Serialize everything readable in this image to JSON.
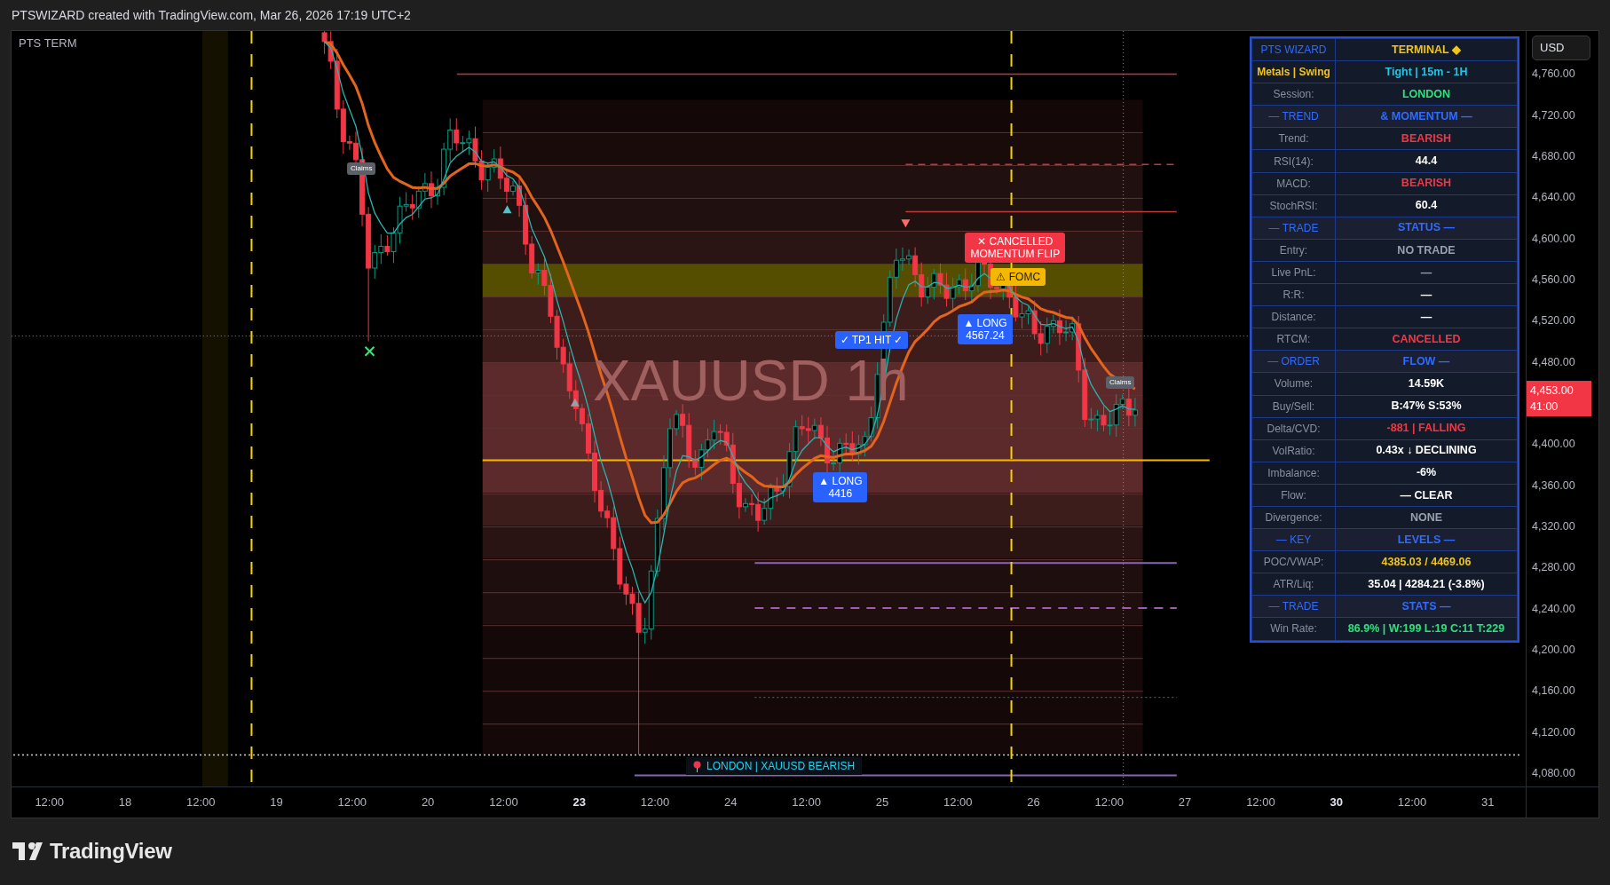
{
  "header": {
    "title": "PTSWIZARD created with TradingView.com, Mar 26, 2026 17:19 UTC+2"
  },
  "chart": {
    "indicator_title": "PTS TERM",
    "symbol_watermark": "XAUUSD  1h",
    "annotations": [
      {
        "kind": "tag",
        "lines": [
          "Claims"
        ]
      },
      {
        "kind": "tag",
        "lines": [
          "Claims"
        ]
      },
      {
        "kind": "signal",
        "lines": [
          "✓ TP1 HIT ✓"
        ]
      },
      {
        "kind": "signal",
        "lines": [
          "▲ LONG",
          "4567.24"
        ]
      },
      {
        "kind": "signal",
        "lines": [
          "▲ LONG",
          "4416"
        ]
      },
      {
        "kind": "alert",
        "lines": [
          "✕ CANCELLED",
          "MOMENTUM FLIP"
        ]
      },
      {
        "kind": "event",
        "lines": [
          "⚠ FOMC"
        ]
      }
    ],
    "session_banner": "LONDON | XAUUSD BEARISH"
  },
  "terminal": {
    "rows": [
      {
        "kind": "title",
        "label": "PTS WIZARD",
        "value": "TERMINAL ◆",
        "color": "#f0c419"
      },
      {
        "kind": "subtitle",
        "label": "Metals | Swing",
        "value": "Tight | 15m - 1H",
        "color": "#22c5e0"
      },
      {
        "kind": "data",
        "label": "Session:",
        "value": "LONDON",
        "color": "#2ee07a"
      },
      {
        "kind": "section",
        "label": "— TREND",
        "value": "& MOMENTUM —"
      },
      {
        "kind": "data",
        "label": "Trend:",
        "value": "BEARISH",
        "color": "#f23645"
      },
      {
        "kind": "data",
        "label": "RSI(14):",
        "value": "44.4",
        "color": "#ffffff"
      },
      {
        "kind": "data",
        "label": "MACD:",
        "value": "BEARISH",
        "color": "#f23645"
      },
      {
        "kind": "data",
        "label": "StochRSI:",
        "value": "60.4",
        "color": "#ffffff"
      },
      {
        "kind": "section",
        "label": "— TRADE",
        "value": "STATUS —"
      },
      {
        "kind": "data",
        "label": "Entry:",
        "value": "NO TRADE",
        "color": "#9aa0ab"
      },
      {
        "kind": "data",
        "label": "Live PnL:",
        "value": "—",
        "color": "#9aa0ab"
      },
      {
        "kind": "data",
        "label": "R:R:",
        "value": "—",
        "color": "#ffffff"
      },
      {
        "kind": "data",
        "label": "Distance:",
        "value": "—",
        "color": "#ffffff"
      },
      {
        "kind": "data",
        "label": "RTCM:",
        "value": "CANCELLED",
        "color": "#f23645"
      },
      {
        "kind": "section",
        "label": "— ORDER",
        "value": "FLOW —"
      },
      {
        "kind": "data",
        "label": "Volume:",
        "value": "14.59K",
        "color": "#ffffff"
      },
      {
        "kind": "data",
        "label": "Buy/Sell:",
        "value": "B:47% S:53%",
        "color": "#ffffff"
      },
      {
        "kind": "data",
        "label": "Delta/CVD:",
        "value": "-881 | FALLING",
        "color": "#f23645"
      },
      {
        "kind": "data",
        "label": "VolRatio:",
        "value": "0.43x ↓ DECLINING",
        "color": "#ffffff"
      },
      {
        "kind": "data",
        "label": "Imbalance:",
        "value": "-6%",
        "color": "#ffffff"
      },
      {
        "kind": "data",
        "label": "Flow:",
        "value": "— CLEAR",
        "color": "#ffffff"
      },
      {
        "kind": "data",
        "label": "Divergence:",
        "value": "NONE",
        "color": "#9aa0ab"
      },
      {
        "kind": "section",
        "label": "— KEY",
        "value": "LEVELS —"
      },
      {
        "kind": "data",
        "label": "POC/VWAP:",
        "value": "4385.03 / 4469.06",
        "color": "#f0c419"
      },
      {
        "kind": "data",
        "label": "ATR/Liq:",
        "value": "35.04 | 4284.21 (-3.8%)",
        "color": "#ffffff"
      },
      {
        "kind": "section",
        "label": "— TRADE",
        "value": "STATS —"
      },
      {
        "kind": "data",
        "label": "Win Rate:",
        "value": "86.9% | W:199 L:19 C:11 T:229",
        "color": "#2ee07a"
      }
    ]
  },
  "price_axis": {
    "currency": "USD",
    "labels": [
      "4,760.00",
      "4,720.00",
      "4,680.00",
      "4,640.00",
      "4,600.00",
      "4,560.00",
      "4,520.00",
      "4,480.00",
      "4,400.00",
      "4,360.00",
      "4,320.00",
      "4,280.00",
      "4,240.00",
      "4,200.00",
      "4,160.00",
      "4,120.00",
      "4,080.00"
    ],
    "last_price": "4,453.00",
    "countdown": "41:00"
  },
  "time_axis": {
    "labels": [
      {
        "text": "12:00",
        "emphasized": false
      },
      {
        "text": "18",
        "emphasized": false
      },
      {
        "text": "12:00",
        "emphasized": false
      },
      {
        "text": "19",
        "emphasized": false
      },
      {
        "text": "12:00",
        "emphasized": false
      },
      {
        "text": "20",
        "emphasized": false
      },
      {
        "text": "12:00",
        "emphasized": false
      },
      {
        "text": "23",
        "emphasized": true
      },
      {
        "text": "12:00",
        "emphasized": false
      },
      {
        "text": "24",
        "emphasized": false
      },
      {
        "text": "12:00",
        "emphasized": false
      },
      {
        "text": "25",
        "emphasized": false
      },
      {
        "text": "12:00",
        "emphasized": false
      },
      {
        "text": "26",
        "emphasized": false
      },
      {
        "text": "12:00",
        "emphasized": false
      },
      {
        "text": "27",
        "emphasized": false
      },
      {
        "text": "12:00",
        "emphasized": false
      },
      {
        "text": "30",
        "emphasized": true
      },
      {
        "text": "12:00",
        "emphasized": false
      },
      {
        "text": "31",
        "emphasized": false
      }
    ]
  },
  "footer": {
    "brand": "TradingView"
  }
}
